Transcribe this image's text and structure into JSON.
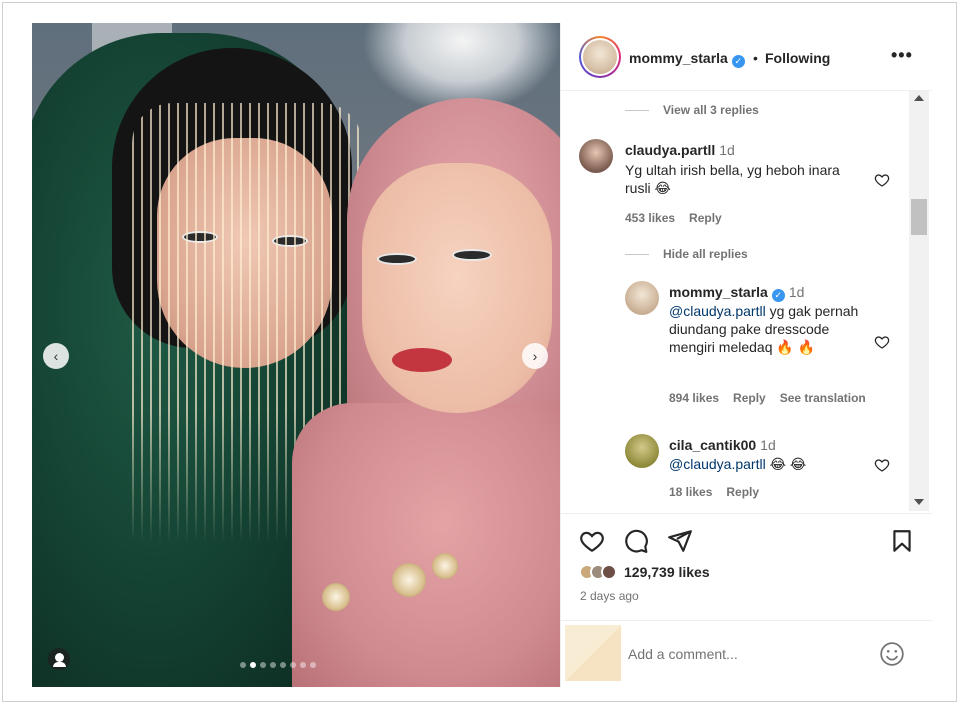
{
  "post": {
    "username": "mommy_starla",
    "separator": "•",
    "follow_status": "Following",
    "more": "•••"
  },
  "comments": {
    "view_replies": "View all 3 replies",
    "hide_replies": "Hide all replies",
    "items": [
      {
        "user": "claudya.partll",
        "time": "1d",
        "text": "Yg ultah irish bella, yg heboh inara rusli 😂",
        "likes": "453 likes",
        "reply": "Reply"
      },
      {
        "user": "mommy_starla",
        "time": "1d",
        "mention": "@claudya.partll",
        "text": " yg gak pernah diundang pake dresscode mengiri meledaq 🔥 🔥",
        "likes": "894 likes",
        "reply": "Reply",
        "translate": "See translation"
      },
      {
        "user": "cila_cantik00",
        "time": "1d",
        "mention": "@claudya.partll",
        "text": " 😂 😂",
        "likes": "18 likes",
        "reply": "Reply"
      }
    ]
  },
  "footer": {
    "likes": "129,739 likes",
    "time_ago": "2 days ago",
    "comment_placeholder": "Add a comment..."
  },
  "icons": {
    "like": "heart-icon",
    "comment": "comment-icon",
    "share": "send-icon",
    "save": "bookmark-icon",
    "emoji": "smiley-icon",
    "verified": "verified-badge-icon"
  },
  "colors": {
    "verified": "#3797f0",
    "mention": "#00376b",
    "muted": "#737373"
  }
}
